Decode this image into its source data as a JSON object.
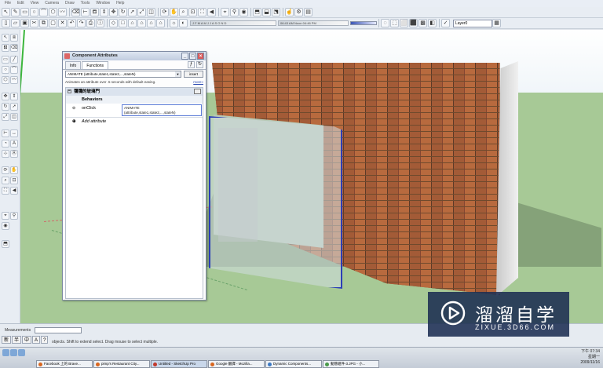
{
  "menubar": {
    "items": [
      "File",
      "Edit",
      "View",
      "Camera",
      "Draw",
      "Tools",
      "Window",
      "Help"
    ]
  },
  "toolbar": {
    "shadow_months": "J F M A M J J A S O N D",
    "shadow_time": "06:43 AM   Noon   04:46 PM",
    "layer_value": "Layer0"
  },
  "dialog": {
    "title": "Component Attributes",
    "tabs": {
      "info": "Info",
      "functions": "Functions"
    },
    "function_select": "ANIMATE (attribute,state1,state2,...,stateN)",
    "insert_label": "insert",
    "description": "Animates an attribute over .5 seconds with default easing.",
    "more_label": "more»",
    "component_name": "彌彌的玻璃門",
    "section_behaviors": "Behaviors",
    "attr_name": "onClick",
    "attr_value_line1": "ANIMATE",
    "attr_value_line2": "(attribute,state1,state2,...,stateN)",
    "add_attribute": "Add attribute"
  },
  "status": {
    "measurements_label": "Measurements",
    "hint": "objects. Shift to extend select. Drag mouse to select multiple.",
    "ime": [
      "新",
      "半",
      "中",
      "A",
      "?"
    ]
  },
  "taskbar": {
    "tasks": [
      "Facebook 上的 Brave...",
      "pimp's Restaurant City...",
      "Untitled - SketchUp Pro",
      "Google 翻譯 - Mozilla...",
      "Dynamic Components...",
      "動態組件-3.JPG - 小..."
    ],
    "clock_line1": "下午 07:34",
    "clock_line2": "星期一",
    "clock_line3": "2009/11/16"
  },
  "watermark": {
    "title": "溜溜自学",
    "url": "ZIXUE.3D66.COM"
  },
  "colors": {
    "selection_blue": "#2b3fb7",
    "ground": "#a7c996",
    "brick": "#8f5435",
    "watermark_bg": "#1c2d52"
  }
}
